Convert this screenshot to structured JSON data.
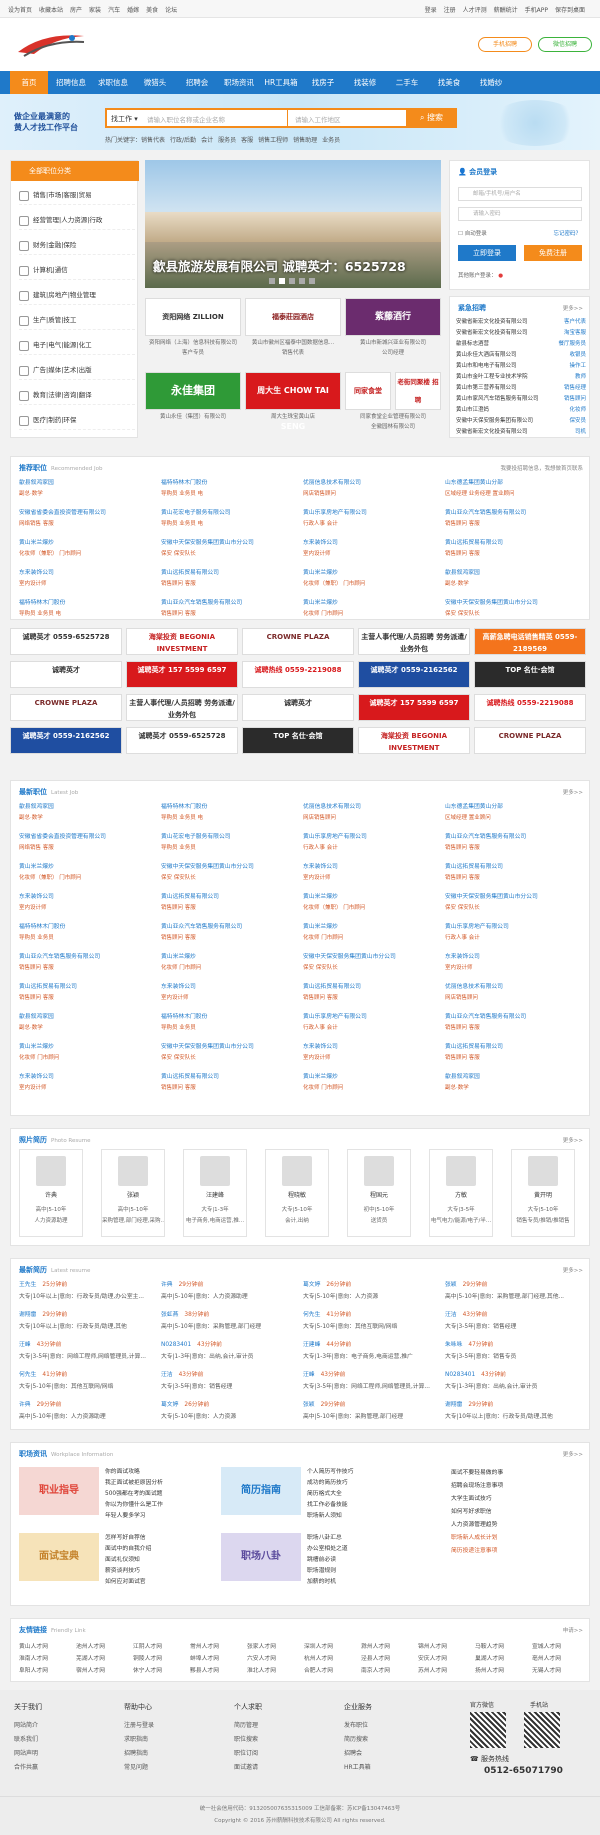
{
  "topbar": {
    "left": [
      "设为首页",
      "收藏本站",
      "房产",
      "家装",
      "汽车",
      "婚嫁",
      "美食",
      "论坛"
    ],
    "right": [
      "登录",
      "注册",
      "人才评测",
      "薪酬统计",
      "手机APP",
      "保存到桌面"
    ]
  },
  "header": {
    "mobile_btn": "手机招聘",
    "wechat_btn": "微信招聘"
  },
  "nav": [
    "首页",
    "招聘信息",
    "求职信息",
    "微猎头",
    "招聘会",
    "职场资讯",
    "HR工具箱",
    "找房子",
    "找装修",
    "二手车",
    "找美食",
    "找婚纱"
  ],
  "banner": {
    "slogan1": "做企业最满意的",
    "slogan2": "黄人才找工作平台"
  },
  "search": {
    "type": "找工作",
    "keyword_placeholder": "请输入职位名称或企业名称",
    "area_placeholder": "请输入工作地区",
    "button": "搜索",
    "hot_label": "热门关键字：",
    "hot": [
      "销售代表",
      "行政/后勤",
      "会计",
      "服务员",
      "客服",
      "销售工程师",
      "销售助理",
      "业务员"
    ]
  },
  "categories": {
    "title": "全部职位分类",
    "items": [
      "销售|市场|客服|贸易",
      "经营管理|人力资源|行政",
      "财务|金融|保险",
      "计算机|通信",
      "建筑|房地产|物业管理",
      "生产|质管|技工",
      "电子|电气|能源|化工",
      "广告|媒体|艺术|出版",
      "教育|法律|咨询|翻译",
      "医疗|制药|环保"
    ]
  },
  "slider": {
    "caption": "歙县旅游发展有限公司  诚聘英才：6525728"
  },
  "logo_ads": [
    {
      "name": "资阳网络 ZILLION",
      "caption": "资阳网络（上海）信息科技有限公司"
    },
    {
      "name": "福泰莊园酒店",
      "caption": "黄山市徽州区福泰中国数据信息..."
    },
    {
      "name": "紫藤酒行",
      "caption": "黄山市新城兴亚业有限公司"
    },
    {
      "name": "永佳集团",
      "caption": "黄山永佳（集团）有限公司"
    },
    {
      "name": "周大生 CHOW TAI SENG",
      "caption": "周大生珠宝黄山店"
    },
    {
      "name": "同家食堂",
      "caption": "同家食堂企业管理有限公司"
    },
    {
      "name": "老街同聚楼 招聘",
      "caption": "全徽园林有限公司"
    }
  ],
  "logo_sub": [
    "客户专员",
    "销售代表",
    "公司经理"
  ],
  "login": {
    "title": "会员登录",
    "user_placeholder": "邮箱/手机号/用户名",
    "pass_placeholder": "请输入密码",
    "auto": "自动登录",
    "forgot": "忘记密码？",
    "login_btn": "立即登录",
    "reg_btn": "免费注册",
    "other": "其他账户登录："
  },
  "urgent": {
    "title": "紧急招聘",
    "more": "更多>>",
    "rows": [
      {
        "c": "安徽省新宏文化投资有限公司",
        "j": "客户代表"
      },
      {
        "c": "安徽省新宏文化投资有限公司",
        "j": "淘宝客服"
      },
      {
        "c": "歙县标志酒营",
        "j": "餐厅服务员"
      },
      {
        "c": "黄山永佳大酒店有限公司",
        "j": "收银员"
      },
      {
        "c": "黄山市和电电子有限公司",
        "j": "操作工"
      },
      {
        "c": "黄山市金叶工程专业技术学院",
        "j": "教师"
      },
      {
        "c": "黄山市第三营养有限公司",
        "j": "销售经理"
      },
      {
        "c": "黄山市家风汽车销售服务有限公司",
        "j": "销售顾问"
      },
      {
        "c": "黄山市江澄妈",
        "j": "化妆师"
      },
      {
        "c": "安徽中天保安服务集团有限公司",
        "j": "保安员"
      },
      {
        "c": "安徽省新宏文化投资有限公司",
        "j": "司机"
      }
    ]
  },
  "recommended": {
    "title": "推荐职位",
    "en": "Recommended Job",
    "more": "我要投招聘信息，我想做首页联系",
    "cells": [
      {
        "co": "歙县叙鸿家园",
        "jb": "副总·数学"
      },
      {
        "co": "福特特林木门股份",
        "jb": "导购员  业务员  电"
      },
      {
        "co": "优丽信息技术有限公司",
        "jb": "网店销售顾问"
      },
      {
        "co": "山东德孟集团黄山分部",
        "jb": "区域经理  业务经理  置业顾问"
      },
      {
        "co": "安徽省省委会直投资管理有限公司",
        "jb": "网络销售  客服"
      },
      {
        "co": "黄山花宏电子服务有限公司",
        "jb": "导购员  业务员  电"
      },
      {
        "co": "黄山乐享房地产有限公司",
        "jb": "行政人事  会计"
      },
      {
        "co": "黄山亚众汽车销售服务有限公司",
        "jb": "销售顾问  客服"
      },
      {
        "co": "黄山米兰爆炒",
        "jb": "化妆师（兼职）  门市顾问"
      },
      {
        "co": "安徽中天保安服务集团黄山市分公司",
        "jb": "保安  保安队长"
      },
      {
        "co": "东来装饰公司",
        "jb": "室内设计师"
      },
      {
        "co": "黄山远拓贸易有限公司",
        "jb": "销售顾问  客服"
      },
      {
        "co": "东来装饰公司",
        "jb": "室内设计师"
      },
      {
        "co": "黄山远拓贸易有限公司",
        "jb": "销售顾问  客服"
      },
      {
        "co": "黄山米兰爆炒",
        "jb": "化妆师（兼职）  门市顾问"
      },
      {
        "co": "歙县叙鸿家园",
        "jb": "副总·数学"
      },
      {
        "co": "福特特林木门股份",
        "jb": "导购员  业务员  电"
      },
      {
        "co": "黄山亚众汽车销售服务有限公司",
        "jb": "销售顾问  客服"
      },
      {
        "co": "黄山米兰爆炒",
        "jb": "化妆师  门市顾问"
      },
      {
        "co": "安徽中天保安服务集团黄山市分公司",
        "jb": "保安  保安队长"
      }
    ]
  },
  "ads": [
    "诚聘英才 0559-6525728",
    "海棠投资 BEGONIA INVESTMENT",
    "CROWNE PLAZA",
    "主营人事代理/人员招聘 劳务派遣/业务外包",
    "高薪急聘电话销售精英 0559-2189569",
    "诚聘英才",
    "诚聘英才 157 5599 6597",
    "诚聘热线 0559-2219088",
    "诚聘英才 0559-2162562",
    "TOP 名仕·会馆",
    "CROWNE PLAZA",
    "主营人事代理/人员招聘 劳务派遣/业务外包",
    "诚聘英才",
    "诚聘英才 157 5599 6597",
    "诚聘热线 0559-2219088",
    "诚聘英才 0559-2162562",
    "诚聘英才 0559-6525728",
    "TOP 名仕·会馆",
    "海棠投资 BEGONIA INVESTMENT",
    "CROWNE PLAZA"
  ],
  "latest_jobs": {
    "title": "最新职位",
    "en": "Latest Job",
    "more": "更多>>",
    "cells": [
      {
        "co": "歙县叙鸿家园",
        "jb": "副总·数学"
      },
      {
        "co": "福特特林木门股份",
        "jb": "导购员  业务员  电"
      },
      {
        "co": "优丽信息技术有限公司",
        "jb": "网店销售顾问"
      },
      {
        "co": "山东德孟集团黄山分部",
        "jb": "区域经理  置业顾问"
      },
      {
        "co": "安徽省省委会直投资管理有限公司",
        "jb": "网络销售  客服"
      },
      {
        "co": "黄山花宏电子服务有限公司",
        "jb": "导购员  业务员"
      },
      {
        "co": "黄山乐享房地产有限公司",
        "jb": "行政人事  会计"
      },
      {
        "co": "黄山亚众汽车销售服务有限公司",
        "jb": "销售顾问  客服"
      },
      {
        "co": "黄山米兰爆炒",
        "jb": "化妆师（兼职）  门市顾问"
      },
      {
        "co": "安徽中天保安服务集团黄山市分公司",
        "jb": "保安  保安队长"
      },
      {
        "co": "东来装饰公司",
        "jb": "室内设计师"
      },
      {
        "co": "黄山远拓贸易有限公司",
        "jb": "销售顾问  客服"
      },
      {
        "co": "东来装饰公司",
        "jb": "室内设计师"
      },
      {
        "co": "黄山远拓贸易有限公司",
        "jb": "销售顾问  客服"
      },
      {
        "co": "黄山米兰爆炒",
        "jb": "化妆师（兼职）  门市顾问"
      },
      {
        "co": "安徽中天保安服务集团黄山市分公司",
        "jb": "保安  保安队长"
      },
      {
        "co": "福特特林木门股份",
        "jb": "导购员  业务员"
      },
      {
        "co": "黄山亚众汽车销售服务有限公司",
        "jb": "销售顾问  客服"
      },
      {
        "co": "黄山米兰爆炒",
        "jb": "化妆师  门市顾问"
      },
      {
        "co": "黄山乐享房地产有限公司",
        "jb": "行政人事  会计"
      },
      {
        "co": "黄山亚众汽车销售服务有限公司",
        "jb": "销售顾问  客服"
      },
      {
        "co": "黄山米兰爆炒",
        "jb": "化妆师  门市顾问"
      },
      {
        "co": "安徽中天保安服务集团黄山市分公司",
        "jb": "保安  保安队长"
      },
      {
        "co": "东来装饰公司",
        "jb": "室内设计师"
      },
      {
        "co": "黄山远拓贸易有限公司",
        "jb": "销售顾问  客服"
      },
      {
        "co": "东来装饰公司",
        "jb": "室内设计师"
      },
      {
        "co": "黄山远拓贸易有限公司",
        "jb": "销售顾问  客服"
      },
      {
        "co": "优丽信息技术有限公司",
        "jb": "网店销售顾问"
      },
      {
        "co": "歙县叙鸿家园",
        "jb": "副总·数学"
      },
      {
        "co": "福特特林木门股份",
        "jb": "导购员  业务员"
      },
      {
        "co": "黄山乐享房地产有限公司",
        "jb": "行政人事  会计"
      },
      {
        "co": "黄山亚众汽车销售服务有限公司",
        "jb": "销售顾问  客服"
      },
      {
        "co": "黄山米兰爆炒",
        "jb": "化妆师  门市顾问"
      },
      {
        "co": "安徽中天保安服务集团黄山市分公司",
        "jb": "保安  保安队长"
      },
      {
        "co": "东来装饰公司",
        "jb": "室内设计师"
      },
      {
        "co": "黄山远拓贸易有限公司",
        "jb": "销售顾问  客服"
      },
      {
        "co": "东来装饰公司",
        "jb": "室内设计师"
      },
      {
        "co": "黄山远拓贸易有限公司",
        "jb": "销售顾问  客服"
      },
      {
        "co": "黄山米兰爆炒",
        "jb": "化妆师  门市顾问"
      },
      {
        "co": "歙县叙鸿家园",
        "jb": "副总·数学"
      }
    ]
  },
  "photo_resume": {
    "title": "照片简历",
    "en": "Photo Resume",
    "more": "更多>>",
    "cards": [
      {
        "n": "许典",
        "d": "高中|5-10年",
        "p": "人力资源助理"
      },
      {
        "n": "张颖",
        "d": "高中|5-10年",
        "p": "采购管理,部门经理,采购..."
      },
      {
        "n": "汪建峰",
        "d": "大专|1-3年",
        "p": "电子商务,电商运营,推..."
      },
      {
        "n": "程晓敏",
        "d": "大专|5-10年",
        "p": "会计,出纳"
      },
      {
        "n": "程国元",
        "d": "初中|5-10年",
        "p": "送货员"
      },
      {
        "n": "方敏",
        "d": "大专|3-5年",
        "p": "电气电力/能源/电子/半..."
      },
      {
        "n": "黄开明",
        "d": "大专|5-10年",
        "p": "销售专员/推销/推销售"
      }
    ]
  },
  "latest_resume": {
    "title": "最新简历",
    "en": "Latest resume",
    "more": "更多>>",
    "cells": [
      {
        "n": "王先生",
        "t": "25分钟前",
        "d": "大专|10年以上|意向：行政专员/助理,办公室主..."
      },
      {
        "n": "许典",
        "t": "29分钟前",
        "d": "高中|5-10年|意向：人力资源助理"
      },
      {
        "n": "葛文婷",
        "t": "26分钟前",
        "d": "大专|5-10年|意向：人力资源"
      },
      {
        "n": "张颖",
        "d": "高中|5-10年|意向：采购管理,部门经理,其他...",
        "t": "29分钟前"
      },
      {
        "n": "谢翔雷",
        "t": "29分钟前",
        "d": "大专|10年以上|意向：行政专员/助理,其他"
      },
      {
        "n": "张虹燕",
        "t": "38分钟前",
        "d": "高中|5-10年|意向：采购管理,部门经理"
      },
      {
        "n": "何先生",
        "t": "41分钟前",
        "d": "大专|5-10年|意向：其他互联网/网络"
      },
      {
        "n": "汪洁",
        "t": "43分钟前",
        "d": "大专|3-5年|意向：销售经理"
      },
      {
        "n": "汪峰",
        "t": "43分钟前",
        "d": "大专|3-5年|意向：网络工程师,网络管理员,计算..."
      },
      {
        "n": "N0283401",
        "t": "43分钟前",
        "d": "大专|1-3年|意向：出纳,会计,审计员"
      },
      {
        "n": "汪建峰",
        "t": "44分钟前",
        "d": "大专|1-3年|意向：电子商务,电商运营,推广"
      },
      {
        "n": "朱咏咏",
        "t": "47分钟前",
        "d": "大专|3-5年|意向：销售专员"
      },
      {
        "n": "何先生",
        "t": "41分钟前",
        "d": "大专|5-10年|意向：其他互联网/网络"
      },
      {
        "n": "汪洁",
        "t": "43分钟前",
        "d": "大专|3-5年|意向：销售经理"
      },
      {
        "n": "汪峰",
        "t": "43分钟前",
        "d": "大专|3-5年|意向：网络工程师,网络管理员,计算..."
      },
      {
        "n": "N0283401",
        "t": "43分钟前",
        "d": "大专|1-3年|意向：出纳,会计,审计员"
      },
      {
        "n": "许典",
        "t": "29分钟前",
        "d": "高中|5-10年|意向：人力资源助理"
      },
      {
        "n": "葛文婷",
        "t": "26分钟前",
        "d": "大专|5-10年|意向：人力资源"
      },
      {
        "n": "张颖",
        "t": "29分钟前",
        "d": "高中|5-10年|意向：采购管理,部门经理"
      },
      {
        "n": "谢翔雷",
        "t": "29分钟前",
        "d": "大专|10年以上|意向：行政专员/助理,其他"
      }
    ]
  },
  "workplace": {
    "title": "职场资讯",
    "en": "Workplace Information",
    "more": "更多>>",
    "pics": [
      "职业指导",
      "简历指南",
      "面试宝典",
      "职场八卦"
    ],
    "list1": [
      "你的面试攻略",
      "我正面试被拒原因分析",
      "500强都在考的面试题",
      "你以为你懂什么是工作",
      "年轻人要多学习"
    ],
    "list2": [
      "个人简历写作技巧",
      "成功的简历技巧",
      "简历格式大全",
      "找工作必备技能",
      "职场新人须知"
    ],
    "list3": [
      "怎样写好自荐信",
      "面试中的自我介绍",
      "面试礼仪须知",
      "薪资谈判技巧",
      "如何应对面试官"
    ],
    "list4": [
      "职场八卦汇总",
      "办公室相处之道",
      "跳槽前必读",
      "职场潜规则",
      "加薪的时机"
    ],
    "hot": [
      "面试不要轻易做的事",
      "招聘会现场注意事项",
      "大学生面试技巧",
      "如何写好求职信",
      "人力资源管理趋势",
      "职场新人成长计划",
      "简历投递注意事项"
    ]
  },
  "friend_links": {
    "title": "友情链接",
    "en": "Friendly Link",
    "more": "申请>>",
    "items": [
      "黄山人才网",
      "池州人才网",
      "江阴人才网",
      "常州人才网",
      "张家人才网",
      "深圳人才网",
      "滁州人才网",
      "锦州人才网",
      "马鞍人才网",
      "宣城人才网",
      "淮南人才网",
      "芜湖人才网",
      "铜陵人才网",
      "蚌埠人才网",
      "六安人才网",
      "杭州人才网",
      "泾县人才网",
      "安庆人才网",
      "巢湖人才网",
      "亳州人才网",
      "阜阳人才网",
      "宿州人才网",
      "休宁人才网",
      "黟县人才网",
      "淮北人才网",
      "合肥人才网",
      "南京人才网",
      "苏州人才网",
      "扬州人才网",
      "无锡人才网"
    ]
  },
  "footer": {
    "cols": [
      {
        "h": "关于我们",
        "items": [
          "网站简介",
          "联系我们",
          "网站声明",
          "合作共赢"
        ]
      },
      {
        "h": "帮助中心",
        "items": [
          "注册与登录",
          "求职指南",
          "招聘指南",
          "常见问题"
        ]
      },
      {
        "h": "个人求职",
        "items": [
          "简历管理",
          "职位搜索",
          "职位订阅",
          "面试邀请"
        ]
      },
      {
        "h": "企业服务",
        "items": [
          "发布职位",
          "简历搜索",
          "招聘会",
          "HR工具箱"
        ]
      }
    ],
    "wechat": "官方微信",
    "mobile": "手机站",
    "hotline_label": "服务热线",
    "hotline": "0512-65071790",
    "icp": "统一社会信用代码：913205007635315009  工信部备案：苏ICP备13047463号",
    "copyright": "Copyright © 2016 苏州薪酬科技技术有限公司 All rights reserved."
  }
}
